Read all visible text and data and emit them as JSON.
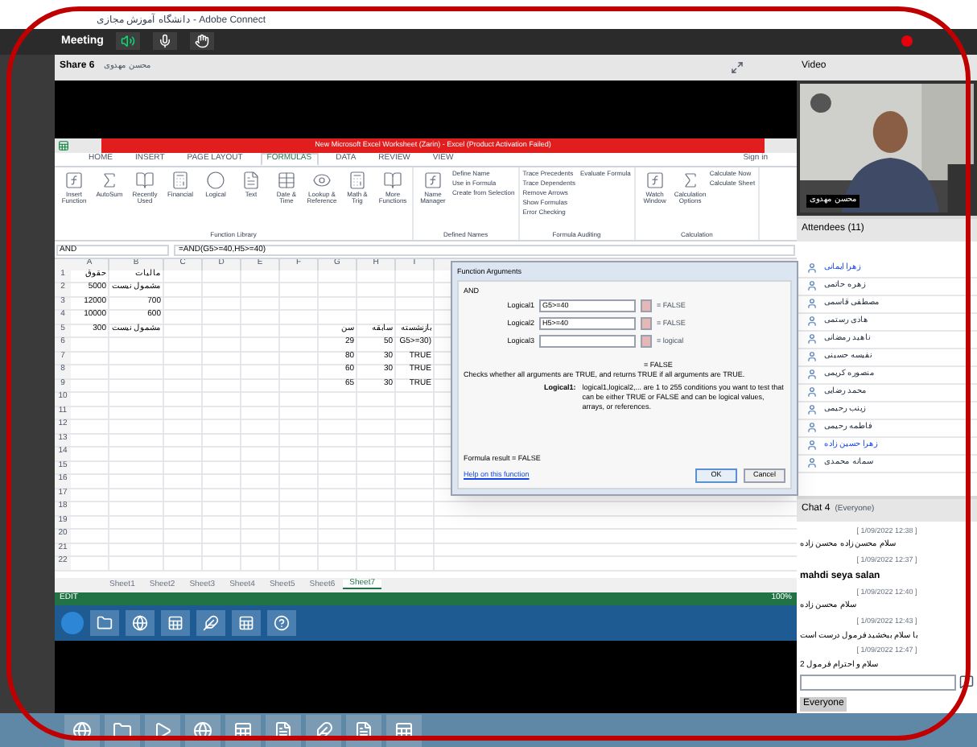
{
  "window": {
    "title": "دانشگاه آموزش مجازی - Adobe Connect"
  },
  "menu_bar": {
    "title": "Meeting"
  },
  "share_pod": {
    "title": "Share 6",
    "presenter": "محسن مهدوی"
  },
  "excel": {
    "title": "New Microsoft Excel Worksheet (Zarin) - Excel (Product Activation Failed)",
    "tabs": [
      {
        "label": "HOME",
        "selected": false
      },
      {
        "label": "INSERT",
        "selected": false
      },
      {
        "label": "PAGE LAYOUT",
        "selected": false
      },
      {
        "label": "FORMULAS",
        "selected": true
      },
      {
        "label": "DATA",
        "selected": false
      },
      {
        "label": "REVIEW",
        "selected": false
      },
      {
        "label": "VIEW",
        "selected": false
      }
    ],
    "sign_in": "Sign in",
    "ribbon_groups": [
      {
        "label": "Function Library",
        "buttons": [
          "Insert Function",
          "AutoSum",
          "Recently Used",
          "Financial",
          "Logical",
          "Text",
          "Date & Time",
          "Lookup & Reference",
          "Math & Trig",
          "More Functions"
        ]
      },
      {
        "label": "Defined Names",
        "buttons": [
          "Name Manager"
        ],
        "small": [
          "Define Name",
          "Use in Formula",
          "Create from Selection"
        ]
      },
      {
        "label": "Formula Auditing",
        "small": [
          "Trace Precedents",
          "Trace Dependents",
          "Remove Arrows",
          "Show Formulas",
          "Error Checking",
          "Evaluate Formula"
        ]
      },
      {
        "label": "Calculation",
        "buttons": [
          "Watch Window",
          "Calculation Options"
        ],
        "small": [
          "Calculate Now",
          "Calculate Sheet"
        ]
      }
    ],
    "name_box": "AND",
    "formula": "=AND(G5>=40,H5>=40)",
    "columns": [
      "A",
      "B",
      "C",
      "D",
      "E",
      "F",
      "G",
      "H",
      "I"
    ],
    "rows": [
      [
        "حقوق",
        "مالیات",
        "",
        "",
        "",
        "",
        "",
        "",
        ""
      ],
      [
        "5000",
        "مشمول نیست",
        "",
        "",
        "",
        "",
        "",
        "",
        ""
      ],
      [
        "12000",
        "700",
        "",
        "",
        "",
        "",
        "",
        "",
        ""
      ],
      [
        "10000",
        "600",
        "",
        "",
        "",
        "",
        "",
        "",
        ""
      ],
      [
        "300",
        "مشمول نیست",
        "",
        "",
        "",
        "",
        "سن",
        "سابقه",
        "بازنشسته"
      ],
      [
        "",
        "",
        "",
        "",
        "",
        "",
        "29",
        "50",
        "G5>=30)"
      ],
      [
        "",
        "",
        "",
        "",
        "",
        "",
        "80",
        "30",
        "TRUE"
      ],
      [
        "",
        "",
        "",
        "",
        "",
        "",
        "60",
        "30",
        "TRUE"
      ],
      [
        "",
        "",
        "",
        "",
        "",
        "",
        "65",
        "30",
        "TRUE"
      ]
    ],
    "row_numbers": [
      "1",
      "2",
      "3",
      "4",
      "5",
      "6",
      "7",
      "8",
      "9",
      "10",
      "11",
      "12",
      "13",
      "14",
      "15",
      "16",
      "17",
      "18",
      "19",
      "20",
      "21",
      "22"
    ],
    "sheets": [
      {
        "label": "Sheet1",
        "selected": false
      },
      {
        "label": "Sheet2",
        "selected": false
      },
      {
        "label": "Sheet3",
        "selected": false
      },
      {
        "label": "Sheet4",
        "selected": false
      },
      {
        "label": "Sheet5",
        "selected": false
      },
      {
        "label": "Sheet6",
        "selected": false
      },
      {
        "label": "Sheet7",
        "selected": true
      }
    ],
    "status": "EDIT",
    "zoom": "100%"
  },
  "dialog": {
    "title": "Function Arguments",
    "function": "AND",
    "args": [
      {
        "label": "Logical1",
        "value": "G5>=40",
        "result": "= FALSE"
      },
      {
        "label": "Logical2",
        "value": "H5>=40",
        "result": "= FALSE"
      },
      {
        "label": "Logical3",
        "result": "= logical"
      }
    ],
    "overall": "= FALSE",
    "description": "Checks whether all arguments are TRUE, and returns TRUE if all arguments are TRUE.",
    "arg_label": "Logical1:",
    "arg_help": "logical1,logical2,... are 1 to 255 conditions you want to test that can be either TRUE or FALSE and can be logical values, arrays, or references.",
    "formula_result": "Formula result =  FALSE",
    "help_link": "Help on this function",
    "ok": "OK",
    "cancel": "Cancel"
  },
  "video_pod": {
    "title": "Video",
    "name": "محسن مهدوی"
  },
  "attendees": {
    "title": "Attendees (11)",
    "items": [
      {
        "name": "زهرا ایمانی",
        "highlight": true
      },
      {
        "name": "زهره حاتمی",
        "highlight": false
      },
      {
        "name": "مصطفی قاسمی",
        "highlight": false
      },
      {
        "name": "هادی رستمی",
        "highlight": false
      },
      {
        "name": "ناهید رمضانی",
        "highlight": false
      },
      {
        "name": "نفیسه حسینی",
        "highlight": false
      },
      {
        "name": "منصوره کریمی",
        "highlight": false
      },
      {
        "name": "محمد رضایی",
        "highlight": false
      },
      {
        "name": "زینب رحیمی",
        "highlight": false
      },
      {
        "name": "فاطمه رحیمی",
        "highlight": false
      },
      {
        "name": "زهرا حسین زاده",
        "highlight": true
      },
      {
        "name": "سمانه محمدی",
        "highlight": false
      }
    ]
  },
  "chat": {
    "title": "Chat 4",
    "scope": "(Everyone)",
    "messages": [
      {
        "time": "[ 1/09/2022 12:38 ]",
        "text": "سلام محسن زاده محسن زاده"
      },
      {
        "time": "[ 1/09/2022 12:37 ]",
        "text": "mahdi seya salan"
      },
      {
        "time": "[ 1/09/2022 12:40 ]",
        "text": "سلام محسن زاده"
      },
      {
        "time": "[ 1/09/2022 12:43 ]",
        "text": "با سلام ببخشید فرمول درست است"
      },
      {
        "time": "[ 1/09/2022 12:47 ]",
        "text": "سلام و احترام فرمول 2"
      }
    ],
    "recipient": "Everyone"
  }
}
